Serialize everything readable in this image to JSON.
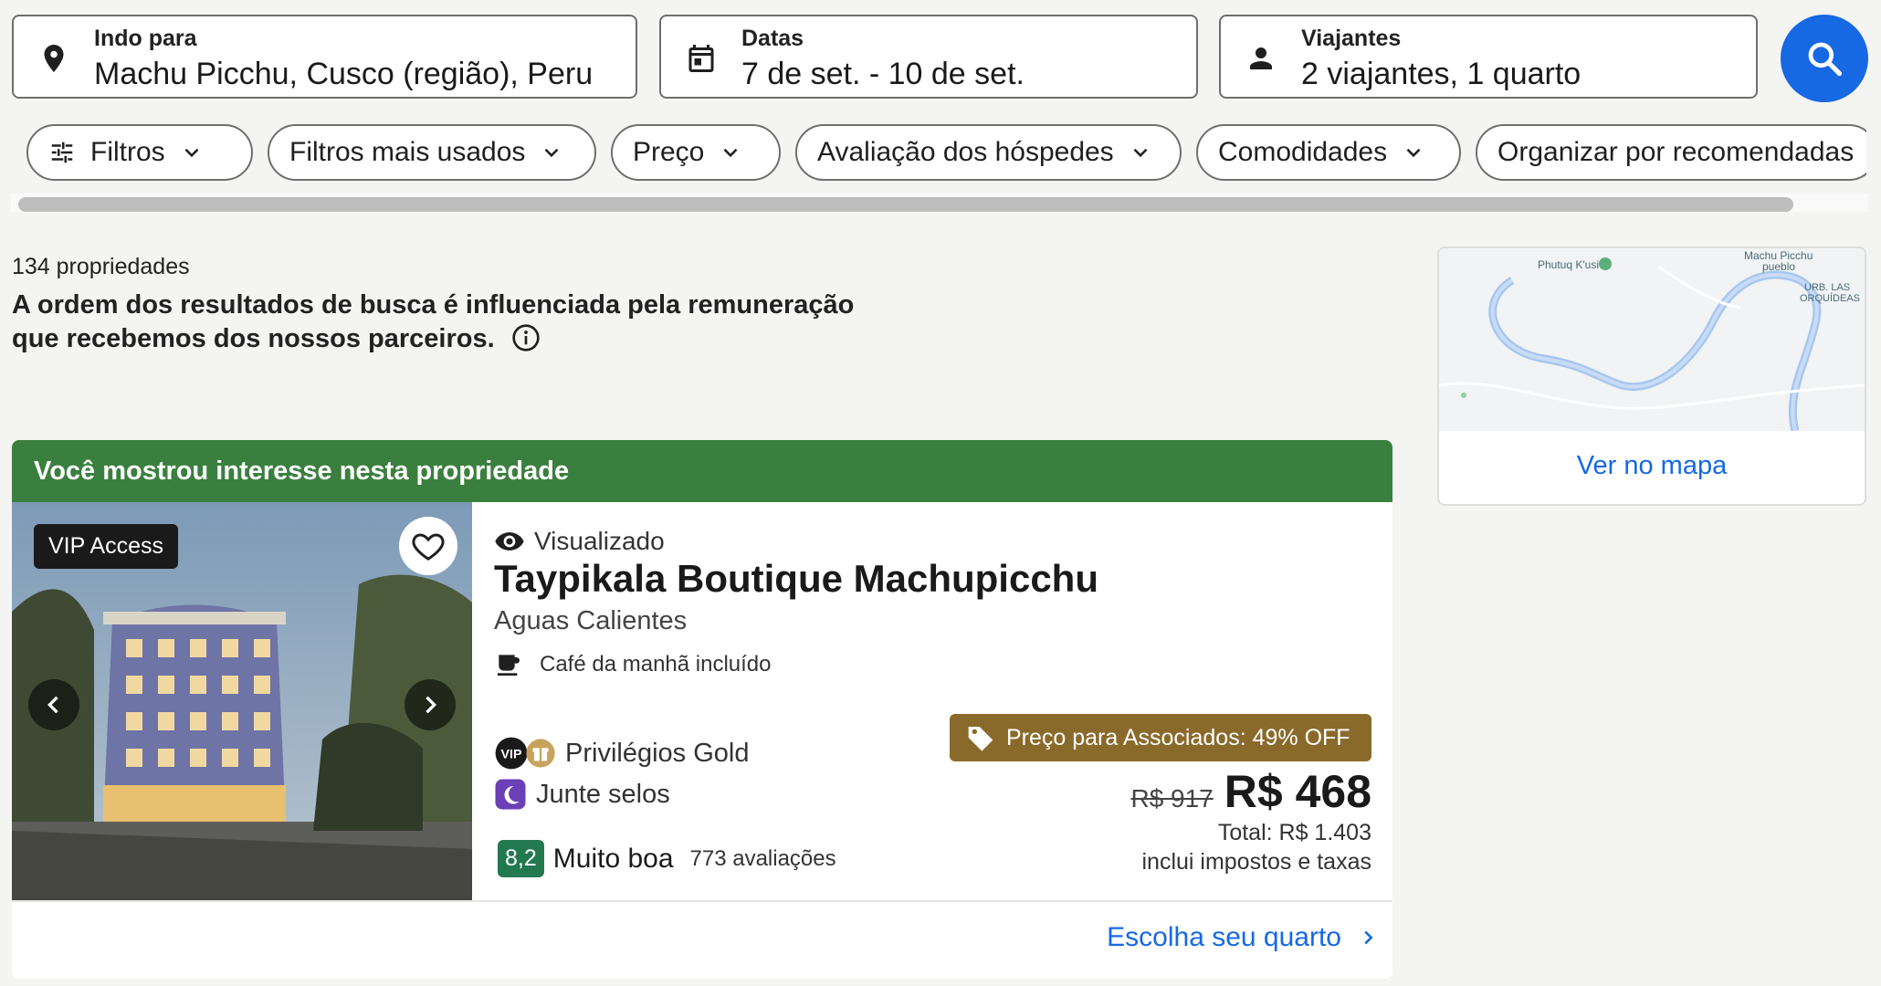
{
  "search": {
    "destination": {
      "label": "Indo para",
      "value": "Machu Picchu, Cusco (região), Peru",
      "icon": "location-pin-icon"
    },
    "dates": {
      "label": "Datas",
      "value": "7 de set. - 10 de set.",
      "icon": "calendar-icon"
    },
    "travelers": {
      "label": "Viajantes",
      "value": "2 viajantes, 1 quarto",
      "icon": "person-icon"
    },
    "search_button_icon": "search-icon"
  },
  "filters": [
    {
      "label": "Filtros"
    },
    {
      "label": "Filtros mais usados"
    },
    {
      "label": "Preço"
    },
    {
      "label": "Avaliação dos hóspedes"
    },
    {
      "label": "Comodidades"
    },
    {
      "label": "Organizar por recomendadas"
    }
  ],
  "results": {
    "count": "134 propriedades",
    "disclaimer": "A ordem dos resultados de busca é influenciada pela remuneração que recebemos dos nossos parceiros."
  },
  "map": {
    "link": "Ver no mapa",
    "labels": {
      "phutuq": "Phutuq K'usi",
      "machu_pueblo_1": "Machu Picchu",
      "machu_pueblo_2": "pueblo",
      "urb_1": "URB. LAS",
      "urb_2": "ORQUÍDEAS"
    }
  },
  "property": {
    "banner": "Você mostrou interesse nesta propriedade",
    "vip_badge": "VIP Access",
    "viewed": "Visualizado",
    "name": "Taypikala Boutique Machupicchu",
    "location": "Aguas Calientes",
    "amenity": "Café da manhã incluído",
    "gold": "Privilégios Gold",
    "vip_mini": "VIP",
    "stamps": "Junte selos",
    "rating_score": "8,2",
    "rating_label": "Muito boa",
    "rating_count": "773 avaliações",
    "deal": "Preço para Associados: 49% OFF",
    "old_price": "R$ 917",
    "price": "R$ 468",
    "total": "Total: R$ 1.403",
    "taxes": "inclui impostos e taxas",
    "choose_room": "Escolha seu quarto"
  },
  "colors": {
    "brand_blue": "#1668e3",
    "banner_green": "#3b7f3f",
    "rating_green": "#227950",
    "deal_gold": "#8a6a2b",
    "stamp_purple": "#6b3fb5"
  }
}
